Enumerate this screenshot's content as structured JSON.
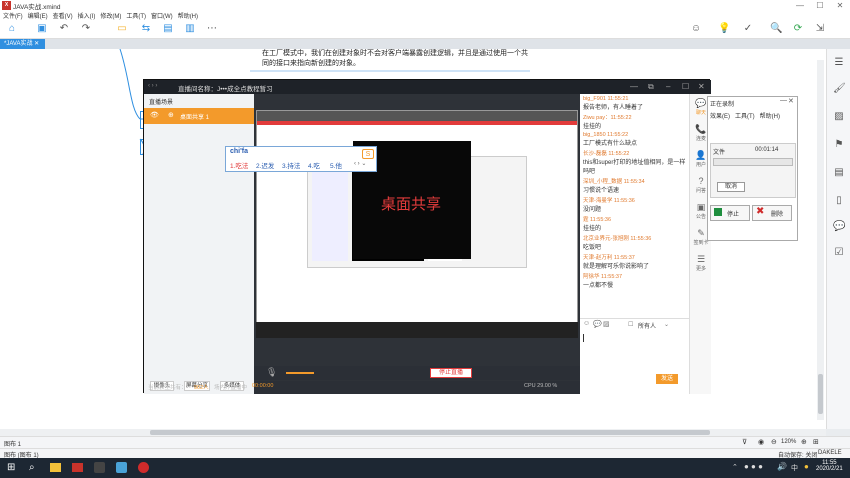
{
  "app": {
    "title": "JAVA实战.xmind"
  },
  "window_controls": [
    "—",
    "☐",
    "✕"
  ],
  "menu": [
    "文件(F)",
    "编辑(E)",
    "查看(V)",
    "插入(I)",
    "修改(M)",
    "工具(T)",
    "窗口(W)",
    "帮助(H)"
  ],
  "tab": {
    "label": "*JAVA实战 ✕"
  },
  "mindmap": {
    "node_text_line1": "在工厂模式中，我们在创建对象时不会对客户端暴露创建逻辑，并且是通过使用一个共",
    "node_text_line2": "同的接口来指向新创建的对象。"
  },
  "live": {
    "title": "直播间名称：J•••成全点教程暂习",
    "left_header": "直播场景",
    "scene_item": "桌面共享 1",
    "screen_label": "桌面共享",
    "btn_camera": "摄像头",
    "btn_screen": "屏幕分享",
    "btn_media": "多媒体",
    "online_label": "当前教室共有：",
    "online_count": "902人",
    "timer_label": "  场内开直播中",
    "timer": "00:00:00",
    "stop_btn": "停止直播",
    "cpu": "CPU 29.00 %",
    "send_btn": "发送",
    "chat_target": "所有人",
    "chat_switch": "☐",
    "rbar": [
      {
        "icon": "chat-icon",
        "glyph": "💬",
        "label": "聊天"
      },
      {
        "icon": "mic-icon",
        "glyph": "📞",
        "label": "连麦"
      },
      {
        "icon": "user-icon",
        "glyph": "👤",
        "label": "用户"
      },
      {
        "icon": "question-icon",
        "glyph": "?",
        "label": "问答"
      },
      {
        "icon": "notice-icon",
        "glyph": "▣",
        "label": "公告"
      },
      {
        "icon": "clipboard-icon",
        "glyph": "✎",
        "label": "签到卡"
      },
      {
        "icon": "more-icon",
        "glyph": "☰",
        "label": "更多"
      }
    ]
  },
  "chat": [
    {
      "name": "big_F901 11:55:21",
      "msg": "报告老师，有人睡着了"
    },
    {
      "name": "Ziwu pay：11:55:22",
      "msg": "挂挂的"
    },
    {
      "name": "big_1850 11:55:22",
      "msg": "工厂模式有什么缺点"
    },
    {
      "name": "长沙-磊磊 11:55:22",
      "msg": "this和super打印的地址值相同，是一样吗吧"
    },
    {
      "name": "深圳_小程_数据 11:55:34",
      "msg": "习惯说个语速"
    },
    {
      "name": "天津-海曼学 11:55:36",
      "msg": "没问题"
    },
    {
      "name": "霆 11:55:36",
      "msg": "挂挂的"
    },
    {
      "name": "北京业界元-张旭刚 11:55:36",
      "msg": "吃饭吧"
    },
    {
      "name": "天津-赵万利 11:55:37",
      "msg": "就是理解可乐你说影响了"
    },
    {
      "name": "阿徐华 11:55:37",
      "msg": "一点都不慢"
    }
  ],
  "ime": {
    "input": "chi'fa",
    "candidates": [
      "1.吃法",
      "2.迟发",
      "3.持法",
      "4.吃",
      "5.他"
    ],
    "nav": "‹ › ⌄"
  },
  "small_dialog": {
    "menu": [
      "效果(E)",
      "工具(T)",
      "帮助(H)"
    ],
    "title": "正在录制",
    "file_label": "文件",
    "file_time": "00:01:14",
    "cancel": "取消",
    "pause": "停止",
    "delete": "删除"
  },
  "status": {
    "left": "图布 1",
    "zoom": "120%",
    "sheet": "图布 (图布 1)",
    "autosave": "自动保存: 关闭",
    "user": "DAKELE"
  },
  "taskbar": {
    "time": "11:55",
    "date": "2020/2/21",
    "lang": "中"
  },
  "colors": {
    "accent": "#f39a2b",
    "tab_blue": "#2f8fe0",
    "red_text": "#e23b3b"
  }
}
